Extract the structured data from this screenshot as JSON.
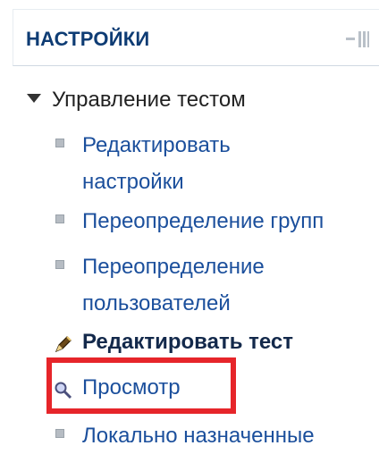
{
  "block": {
    "title": "НАСТРОЙКИ"
  },
  "tree": {
    "root_label": "Управление тестом",
    "items": [
      {
        "line1": "Редактировать",
        "line2": "настройки"
      },
      {
        "line1": "Переопределение групп"
      },
      {
        "line1": "Переопределение",
        "line2": "пользователей"
      },
      {
        "line1": "Редактировать тест"
      },
      {
        "line1": "Просмотр"
      },
      {
        "line1": "Локально назначенные"
      }
    ]
  },
  "colors": {
    "title": "#0e3c74",
    "link": "#1b4f9c",
    "highlight": "#e6252a"
  },
  "icons": {
    "collapse": "triangle-down-icon",
    "block_controls": "block-controls-icon",
    "bullet": "square-bullet-icon",
    "edit": "edit-pencil-icon",
    "preview": "magnifier-icon"
  }
}
